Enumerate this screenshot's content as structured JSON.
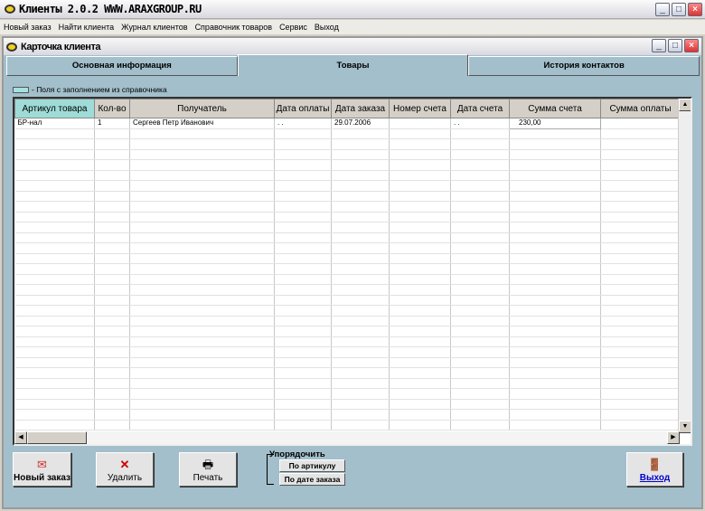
{
  "app_title": "Клиенты 2.0.2 WWW.ARAXGROUP.RU",
  "menu": [
    "Новый заказ",
    "Найти клиента",
    "Журнал клиентов",
    "Справочник товаров",
    "Сервис",
    "Выход"
  ],
  "window_title": "Карточка клиента",
  "tabs": [
    {
      "label": "Основная информация"
    },
    {
      "label": "Товары",
      "active": true
    },
    {
      "label": "История контактов"
    }
  ],
  "legend": "- Поля с заполнением из справочника",
  "accent_color": "#9fdcd8",
  "columns": [
    "Артикул товара",
    "Кол-во",
    "Получатель",
    "Дата оплаты",
    "Дата заказа",
    "Номер счета",
    "Дата счета",
    "Сумма счета",
    "Сумма оплаты"
  ],
  "rows": [
    [
      "БР-нал",
      "1",
      "Сергеев Петр Иванович",
      ". .",
      "29.07.2006",
      "",
      ". .",
      "230,00",
      ""
    ]
  ],
  "buttons": {
    "new_order": "Новый заказ",
    "delete": "Удалить",
    "print": "Печать",
    "exit": "Выход"
  },
  "sort": {
    "label": "Упорядочить",
    "by_article": "По артикулу",
    "by_date": "По дате заказа"
  }
}
